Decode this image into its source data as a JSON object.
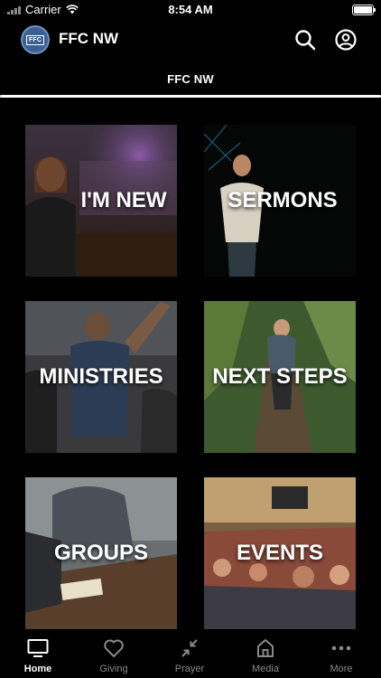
{
  "status_bar": {
    "carrier": "Carrier",
    "time": "8:54 AM"
  },
  "header": {
    "logo_text": "FFC",
    "title": "FFC NW"
  },
  "tab": {
    "label": "FFC NW"
  },
  "tiles": [
    {
      "label": "I'M NEW"
    },
    {
      "label": "SERMONS"
    },
    {
      "label": "MINISTRIES"
    },
    {
      "label": "NEXT STEPS"
    },
    {
      "label": "GROUPS"
    },
    {
      "label": "EVENTS"
    }
  ],
  "nav": [
    {
      "label": "Home",
      "icon": "monitor-icon"
    },
    {
      "label": "Giving",
      "icon": "heart-icon"
    },
    {
      "label": "Prayer",
      "icon": "collapse-arrows-icon"
    },
    {
      "label": "Media",
      "icon": "house-icon"
    },
    {
      "label": "More",
      "icon": "more-dots-icon"
    }
  ],
  "colors": {
    "background": "#000000",
    "active": "#ffffff",
    "inactive": "#8a8a8a"
  }
}
